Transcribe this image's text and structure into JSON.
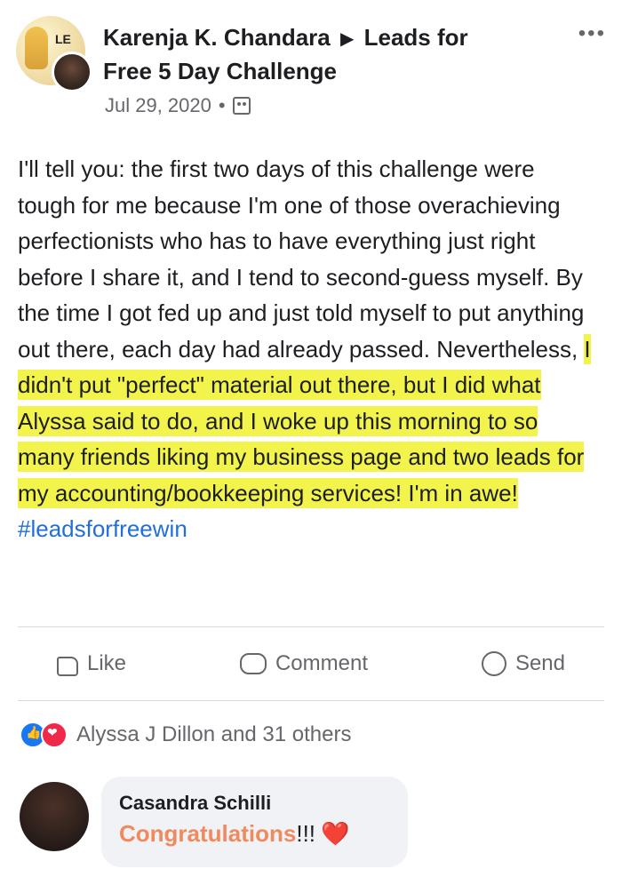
{
  "post": {
    "author": "Karenja K. Chandara",
    "arrow": "▶",
    "group": "Leads for Free 5 Day Challenge",
    "date": "Jul 29, 2020",
    "separator": "•",
    "more": "•••",
    "text_intro": "I'll tell you: the first two days of this challenge were tough for me because I'm one of those overachieving perfectionists who has to have everything just right before I share it, and I tend to second-guess myself. By the time I got fed up and just told myself to put anything out there, each day had already passed. Nevertheless, ",
    "text_highlight": "I didn't put \"perfect\" material out there, but I did what Alyssa said to do, and I woke up this morning to so many friends liking my business page and two leads for my accounting/bookkeeping services! I'm in awe!",
    "hashtag": "#leadsforfreewin"
  },
  "actions": {
    "like_label": "Like",
    "comment_label": "Comment",
    "send_label": "Send"
  },
  "reactions": {
    "summary": "Alyssa J Dillon and 31 others"
  },
  "comment": {
    "author": "Casandra Schilli",
    "text": "Congratulations",
    "exclamations": "!!!",
    "emoji": "❤️"
  },
  "avatar": {
    "overlay_text": "LE"
  },
  "colors": {
    "highlight": "#f3f44b",
    "hashtag": "#216fdb",
    "comment_text": "#f08a5d",
    "like_reaction": "#1877f2",
    "love_reaction": "#f02849"
  },
  "icons": {
    "more": "more-options-icon",
    "group": "group-privacy-icon",
    "like": "like-icon",
    "comment": "comment-icon",
    "send": "messenger-send-icon"
  }
}
